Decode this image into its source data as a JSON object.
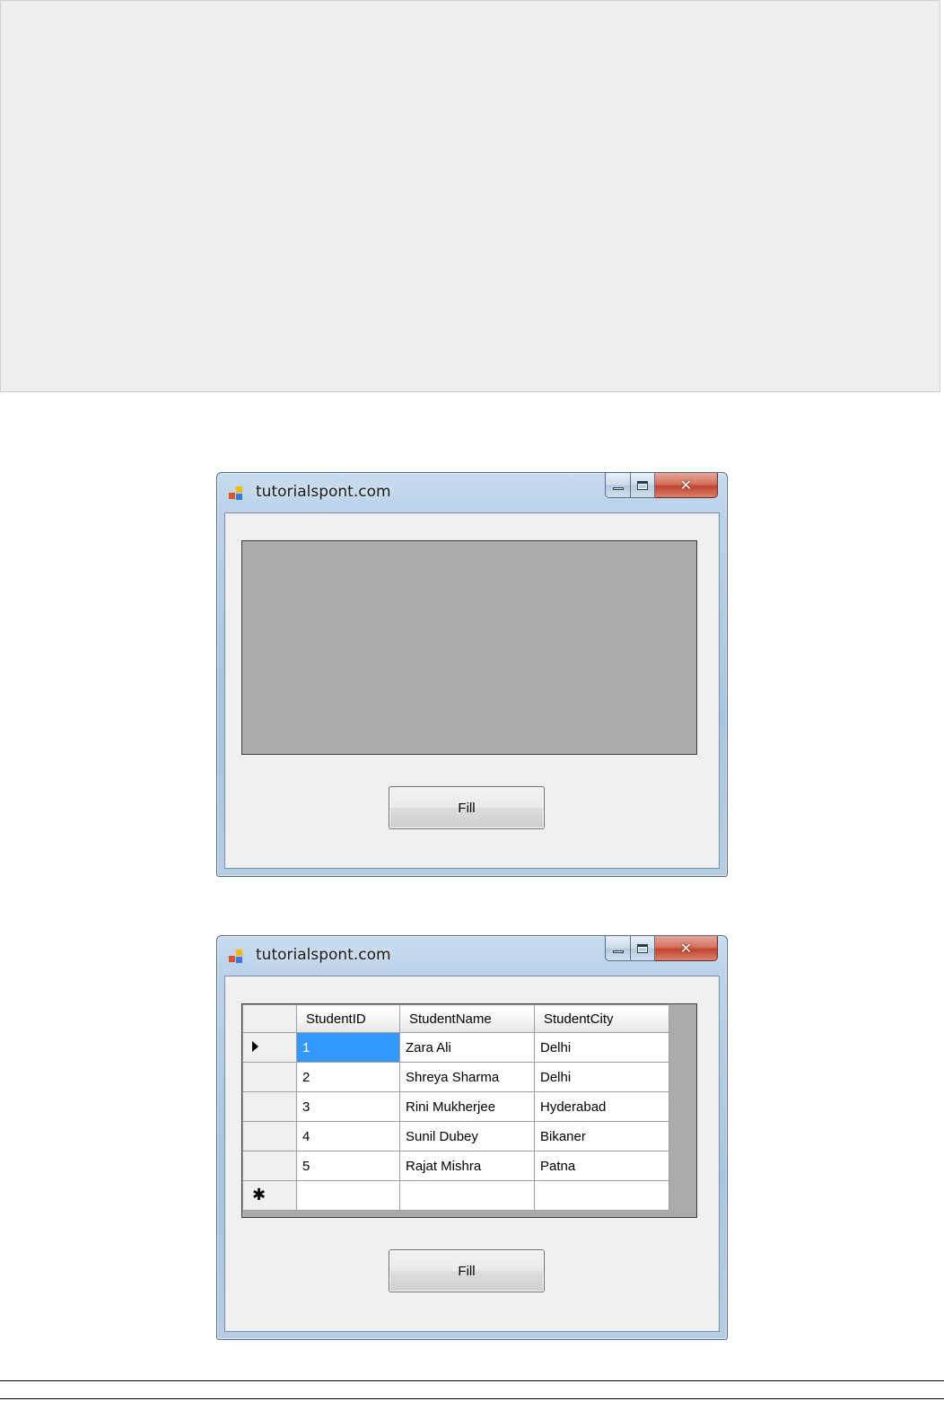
{
  "windows": [
    {
      "title": "tutorialspont.com",
      "fill_button": "Fill"
    },
    {
      "title": "tutorialspont.com",
      "fill_button": "Fill",
      "grid": {
        "columns": [
          "StudentID",
          "StudentName",
          "StudentCity"
        ],
        "rows": [
          [
            "1",
            "Zara Ali",
            "Delhi"
          ],
          [
            "2",
            "Shreya Sharma",
            "Delhi"
          ],
          [
            "3",
            "Rini Mukherjee",
            "Hyderabad"
          ],
          [
            "4",
            "Sunil Dubey",
            "Bikaner"
          ],
          [
            "5",
            "Rajat Mishra",
            "Patna"
          ]
        ]
      }
    }
  ],
  "icons": {
    "current_row": "row-pointer-icon",
    "new_row": "new-row-star-icon",
    "app": "form-app-icon",
    "close": "close-icon",
    "minimize": "minimize-icon",
    "maximize": "maximize-icon"
  },
  "colors": {
    "selection": "#3399ff",
    "grid_background": "#ababab",
    "client_background": "#f0f0f0",
    "close_button": "#c1452f"
  }
}
